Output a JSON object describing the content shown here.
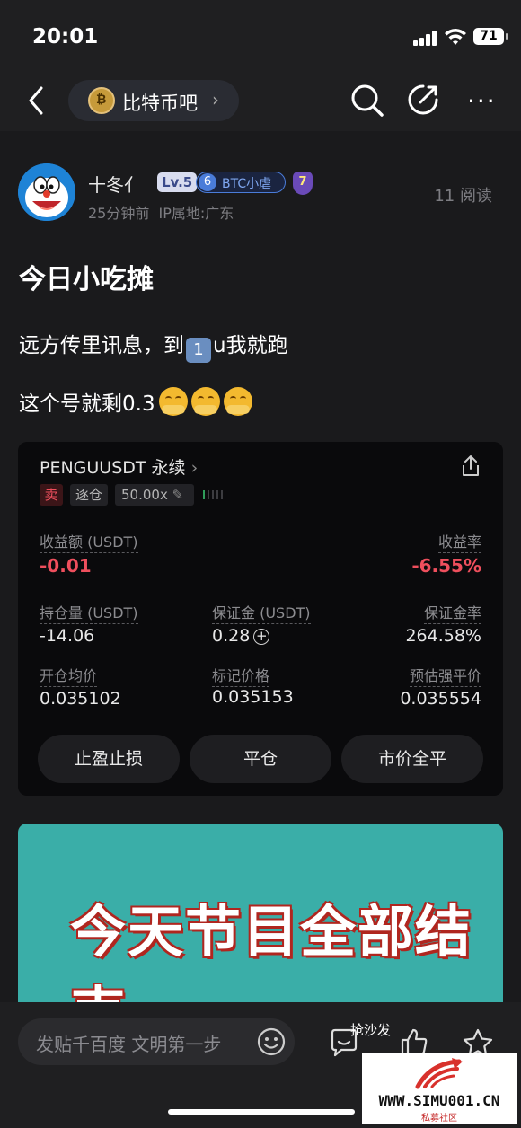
{
  "status_bar": {
    "time": "20:01",
    "battery": "71"
  },
  "nav": {
    "forum_name": "比特币吧",
    "forum_chevron": "›"
  },
  "post": {
    "author": "十冬亻",
    "level": "Lv.5",
    "badge_level": "6",
    "badge_text": "BTC小虐",
    "shield_level": "7",
    "time": "25分钟前",
    "ip": "IP属地:广东",
    "read_count": "11 阅读",
    "title": "今日小吃摊",
    "line1_before": "远方传里讯息，到",
    "line1_keycap": "1",
    "line1_after": "u我就跑",
    "line2": "这个号就剩0.3"
  },
  "trade_card": {
    "pair": "PENGUUSDT 永续",
    "side": "卖",
    "margin_mode": "逐仓",
    "leverage": "50.00x",
    "pnl_label": "收益额 (USDT)",
    "pnl_value": "-0.01",
    "roe_label": "收益率",
    "roe_value": "-6.55%",
    "position_label": "持仓量 (USDT)",
    "position_value": "-14.06",
    "margin_label": "保证金 (USDT)",
    "margin_value": "0.28",
    "margin_ratio_label": "保证金率",
    "margin_ratio_value": "264.58%",
    "entry_label": "开仓均价",
    "entry_value": "0.035102",
    "mark_label": "标记价格",
    "mark_value": "0.035153",
    "liq_label": "预估强平价",
    "liq_value": "0.035554",
    "btn_tpsl": "止盈止损",
    "btn_close": "平仓",
    "btn_market_close": "市价全平"
  },
  "image_caption": "今天节目全部结束",
  "bottom_bar": {
    "comment_placeholder": "发贴千百度 文明第一步",
    "sofa_label": "抢沙发"
  },
  "watermark": {
    "text": "WWW.SIMU001.CN",
    "sub": "私募社区"
  },
  "colors": {
    "negative": "#ef4f5d",
    "accent": "#4a7cd9",
    "background": "#1a1a1c"
  }
}
